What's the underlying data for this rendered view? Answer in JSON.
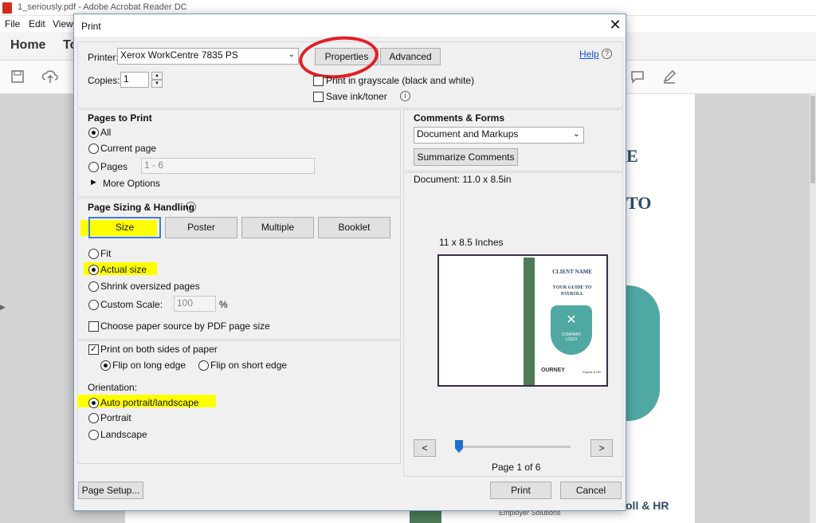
{
  "app": {
    "window_title": "1_seriously.pdf - Adobe Acrobat Reader DC",
    "menu": [
      "File",
      "Edit",
      "View"
    ],
    "nav_home": "Home",
    "nav_tools": "To",
    "background_doc": {
      "heading_1": "E",
      "heading_2": "TO",
      "footer_brand": "oll & HR",
      "employer_text": "Employer Solutions"
    }
  },
  "dialog": {
    "title": "Print",
    "close_glyph": "✕",
    "printer_label": "Printer:",
    "printer_value": "Xerox WorkCentre 7835 PS",
    "properties_label": "Properties",
    "advanced_label": "Advanced",
    "help_label": "Help",
    "copies_label": "Copies:",
    "copies_value": "1",
    "grayscale_label": "Print in grayscale (black and white)",
    "save_ink_label": "Save ink/toner",
    "pages_to_print": {
      "heading": "Pages to Print",
      "all": "All",
      "current_page": "Current page",
      "pages": "Pages",
      "pages_value": "1 - 6",
      "more_options": "More Options"
    },
    "page_sizing": {
      "heading": "Page Sizing & Handling",
      "size_btn": "Size",
      "poster_btn": "Poster",
      "multiple_btn": "Multiple",
      "booklet_btn": "Booklet",
      "fit": "Fit",
      "actual_size": "Actual size",
      "shrink": "Shrink oversized pages",
      "custom_scale": "Custom Scale:",
      "custom_scale_value": "100",
      "percent": "%",
      "paper_source": "Choose paper source by PDF page size"
    },
    "duplex": {
      "both_sides": "Print on both sides of paper",
      "long_edge": "Flip on long edge",
      "short_edge": "Flip on short edge"
    },
    "orientation": {
      "heading": "Orientation:",
      "auto": "Auto portrait/landscape",
      "portrait": "Portrait",
      "landscape": "Landscape"
    },
    "comments_forms": {
      "heading": "Comments & Forms",
      "select_value": "Document and Markups",
      "summarize_btn": "Summarize Comments"
    },
    "preview": {
      "document_size": "Document: 11.0 x 8.5in",
      "sheet_size": "11 x 8.5 Inches",
      "page_indicator": "Page 1 of 6",
      "prev_glyph": "<",
      "next_glyph": ">",
      "slider_position": 0,
      "client_name": "CLIENT NAME",
      "guide_line1": "YOUR GUIDE TO",
      "guide_line2": "PAYROLL",
      "logo_text": "COMPANY LOGO",
      "brand": "OURNEY",
      "brand_sub": "Payroll & HR"
    },
    "page_setup_btn": "Page Setup...",
    "print_btn": "Print",
    "cancel_btn": "Cancel"
  }
}
